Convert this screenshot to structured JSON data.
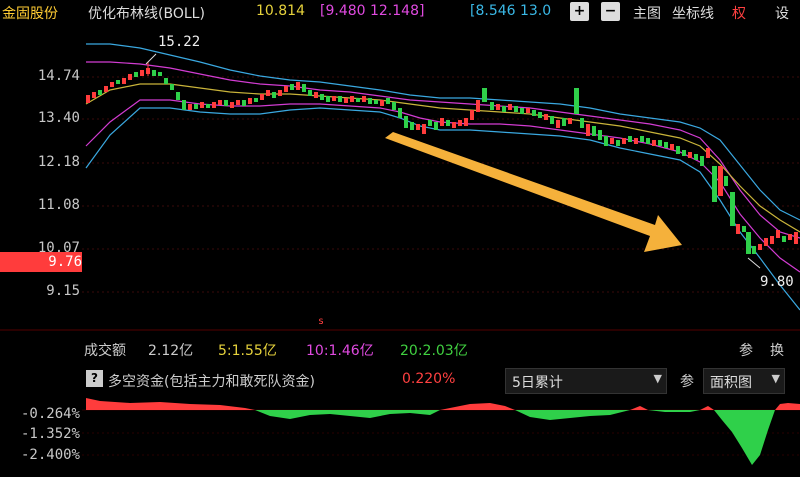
{
  "header": {
    "stock_name": "金固股份",
    "indicator_name": "优化布林线(BOLL)",
    "mid_value": "10.814",
    "band_values": "[9.480  12.148]",
    "band2_values": "[8.546  13.0",
    "plus_label": "+",
    "minus_label": "−",
    "main_chart": "主图",
    "axis_line": "坐标线",
    "rights": "权",
    "settings": "设"
  },
  "price_axis": {
    "ticks": [
      "14.74",
      "13.40",
      "12.18",
      "11.08",
      "10.07",
      "9.15"
    ],
    "current_price": "9.76"
  },
  "annotations": {
    "high_label": "15.22",
    "low_label": "9.80",
    "marker": "s"
  },
  "volume_bar": {
    "title": "成交额",
    "total": "2.12亿",
    "ma5": "5:1.55亿",
    "ma10": "10:1.46亿",
    "ma20": "20:2.03亿",
    "param": "参",
    "switch": "换"
  },
  "money_flow": {
    "help": "?",
    "title": "多空资金(包括主力和敢死队资金)",
    "value": "0.220%",
    "period_select": "5日累计",
    "param": "参",
    "chart_type_select": "面积图",
    "ticks": [
      "-0.264%",
      "-1.352%",
      "-2.400%"
    ]
  },
  "colors": {
    "up": "#ff3c3c",
    "down": "#2fd04a",
    "mid_line": "#c9b43a",
    "band_inner": "#d23cd2",
    "band_outer": "#3aa8e0",
    "arrow": "#f5b13b",
    "yellow_text": "#e6d23c",
    "magenta_text": "#e04ae0",
    "cyan_text": "#3ab8e6",
    "red_text": "#ff4040",
    "green_text": "#40d040"
  }
}
